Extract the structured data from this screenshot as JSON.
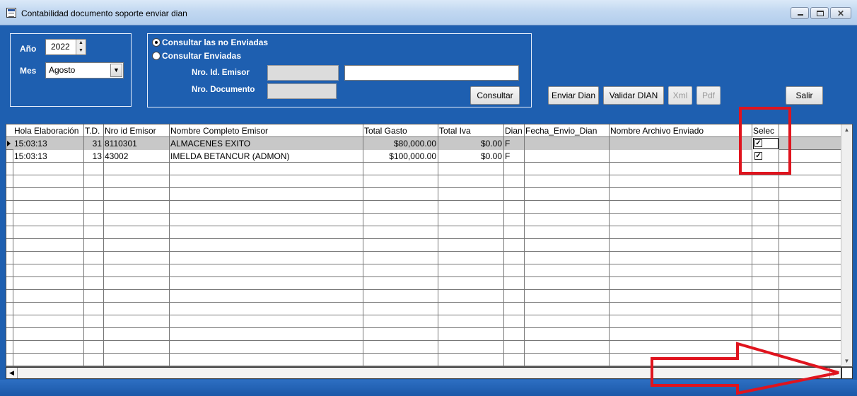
{
  "window": {
    "title": "Contabilidad documento soporte enviar dian"
  },
  "filters": {
    "year_label": "Año",
    "year_value": "2022",
    "month_label": "Mes",
    "month_value": "Agosto"
  },
  "query": {
    "radio_not_sent": "Consultar las no Enviadas",
    "radio_sent": "Consultar Enviadas",
    "selected": "not_sent",
    "issuer_id_label": "Nro. Id. Emisor",
    "issuer_id_value": "",
    "issuer_name_value": "",
    "document_label": "Nro. Documento",
    "document_value": "",
    "consult_button": "Consultar"
  },
  "toolbar": {
    "send_dian": "Enviar Dian",
    "validate_dian": "Validar DIAN",
    "xml": "Xml",
    "pdf": "Pdf",
    "exit": "Salir"
  },
  "grid": {
    "columns": [
      "Hola Elaboración",
      "T.D.",
      "Nro id Emisor",
      "Nombre Completo Emisor",
      "Total Gasto",
      "Total Iva",
      "Dian",
      "Fecha_Envio_Dian",
      "Nombre Archivo Enviado",
      "Selec"
    ],
    "rows": [
      {
        "hora": "15:03:13",
        "td": "31",
        "nro_id": "8110301",
        "nombre": "ALMACENES EXITO",
        "total_gasto": "$80,000.00",
        "total_iva": "$0.00",
        "dian": "F",
        "fecha_envio": "",
        "archivo": "",
        "selec": true
      },
      {
        "hora": "15:03:13",
        "td": "13",
        "nro_id": "43002",
        "nombre": "IMELDA BETANCUR (ADMON)",
        "total_gasto": "$100,000.00",
        "total_iva": "$0.00",
        "dian": "F",
        "fecha_envio": "",
        "archivo": "",
        "selec": true
      }
    ],
    "empty_rows": 16
  },
  "annotations": {
    "highlight_color": "#e0141e"
  }
}
